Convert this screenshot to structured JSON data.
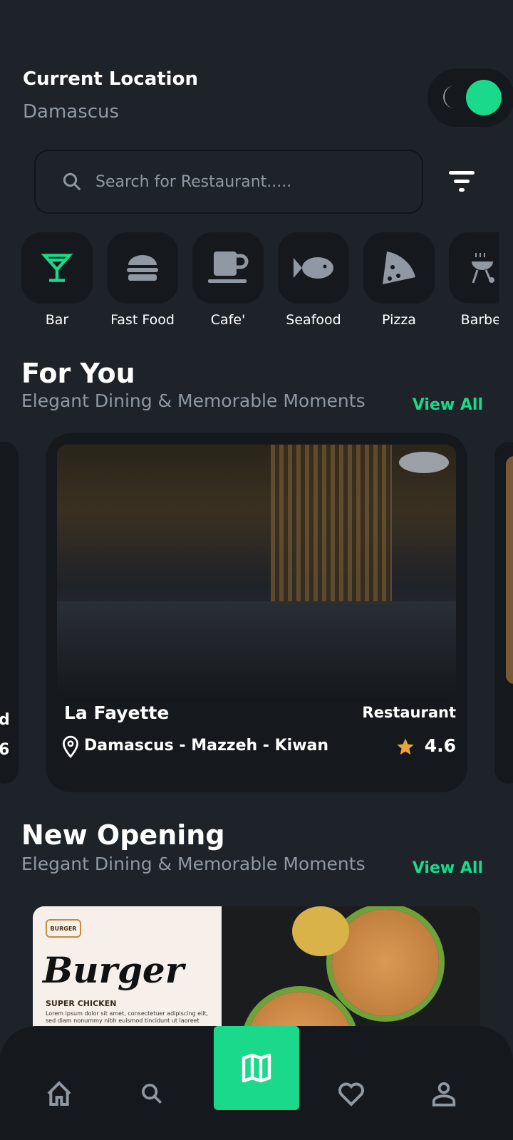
{
  "header": {
    "title": "Current Location",
    "city": "Damascus"
  },
  "theme_toggle": {
    "icon": "moon-icon",
    "state": "on",
    "accent": "#1ad98a"
  },
  "search": {
    "placeholder": "Search for Restaurant.....",
    "value": ""
  },
  "categories": [
    {
      "label": "Bar",
      "icon": "cocktail-icon",
      "active": true
    },
    {
      "label": "Fast Food",
      "icon": "burger-icon"
    },
    {
      "label": "Cafe'",
      "icon": "coffee-icon"
    },
    {
      "label": "Seafood",
      "icon": "fish-icon"
    },
    {
      "label": "Pizza",
      "icon": "pizza-icon"
    },
    {
      "label": "Barbec",
      "icon": "grill-icon"
    }
  ],
  "for_you": {
    "title": "For You",
    "subtitle": "Elegant Dining & Memorable Moments",
    "view_all": "View All",
    "card": {
      "name": "La Fayette",
      "type": "Restaurant",
      "location": "Damascus - Mazzeh - Kiwan",
      "rating": "4.6"
    },
    "left_peek": {
      "name_tail": "d",
      "rating_tail": "6"
    }
  },
  "new_opening": {
    "title": "New Opening",
    "subtitle": "Elegant Dining & Memorable Moments",
    "view_all": "View All",
    "banner": {
      "logo": "BURGER",
      "headline": "Burger",
      "tag": "SUPER CHICKEN",
      "body": "Lorem ipsum dolor sit amet, consectetuer adipiscing elit, sed diam nonummy nibh euismod tincidunt ut laoreet"
    }
  },
  "nav": {
    "items": [
      "home-icon",
      "search-icon",
      "map-icon",
      "heart-icon",
      "user-icon"
    ],
    "active": "map-icon"
  }
}
